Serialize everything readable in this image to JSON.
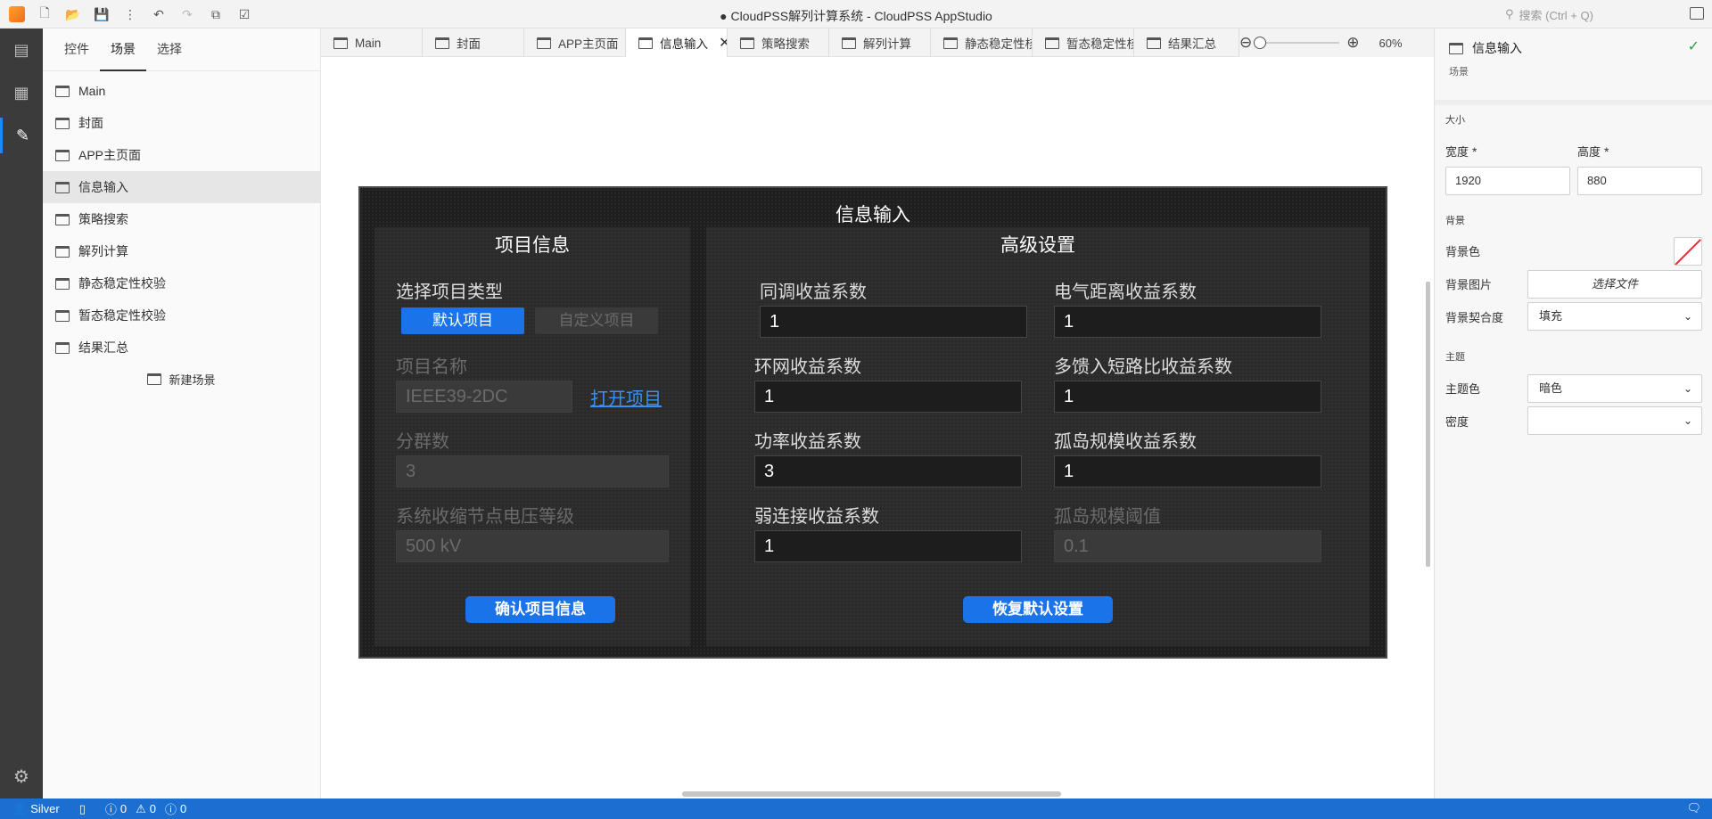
{
  "window": {
    "title": "● CloudPSS解列计算系统 - CloudPSS AppStudio",
    "search_placeholder": "搜索 (Ctrl + Q)"
  },
  "sidebar": {
    "tabs": [
      "控件",
      "场景",
      "选择"
    ],
    "scenes": [
      "Main",
      "封面",
      "APP主页面",
      "信息输入",
      "策略搜索",
      "解列计算",
      "静态稳定性校验",
      "暂态稳定性校验",
      "结果汇总"
    ],
    "new_scene": "新建场景"
  },
  "doc_tabs": [
    "Main",
    "封面",
    "APP主页面",
    "信息输入",
    "策略搜索",
    "解列计算",
    "静态稳定性核",
    "暂态稳定性核",
    "结果汇总"
  ],
  "zoom": {
    "level": "60%"
  },
  "design": {
    "title": "信息输入",
    "project": {
      "title": "项目信息",
      "type_label": "选择项目类型",
      "type_default": "默认项目",
      "type_custom": "自定义项目",
      "name_label": "项目名称",
      "name_value": "IEEE39-2DC",
      "open_link": "打开项目",
      "groups_label": "分群数",
      "groups_value": "3",
      "voltage_label": "系统收缩节点电压等级",
      "voltage_value": "500 kV",
      "confirm_button": "确认项目信息"
    },
    "advanced": {
      "title": "高级设置",
      "fields": [
        {
          "label": "同调收益系数",
          "value": "1"
        },
        {
          "label": "电气距离收益系数",
          "value": "1"
        },
        {
          "label": "环网收益系数",
          "value": "1"
        },
        {
          "label": "多馈入短路比收益系数",
          "value": "1"
        },
        {
          "label": "功率收益系数",
          "value": "3"
        },
        {
          "label": "孤岛规模收益系数",
          "value": "1"
        },
        {
          "label": "弱连接收益系数",
          "value": "1"
        },
        {
          "label": "孤岛规模阈值",
          "value": "0.1"
        }
      ],
      "reset_button": "恢复默认设置"
    }
  },
  "properties": {
    "name": "信息输入",
    "type": "场景",
    "size_section": "大小",
    "width_label": "宽度",
    "width_value": "1920",
    "height_label": "高度",
    "height_value": "880",
    "required_mark": "*",
    "bg_section": "背景",
    "bg_color_label": "背景色",
    "bg_image_label": "背景图片",
    "bg_image_button": "选择文件",
    "bg_fit_label": "背景契合度",
    "bg_fit_value": "填充",
    "theme_section": "主题",
    "theme_color_label": "主题色",
    "theme_color_value": "暗色",
    "density_label": "密度",
    "density_value": ""
  },
  "status": {
    "user": "Silver",
    "errors": "0",
    "warnings": "0",
    "infos": "0"
  },
  "colors": {
    "accent": "#1a73e8",
    "statusbar": "#1a6fd1",
    "activitybar": "#3b3b3b",
    "design_bg": "#1f1f1f"
  }
}
